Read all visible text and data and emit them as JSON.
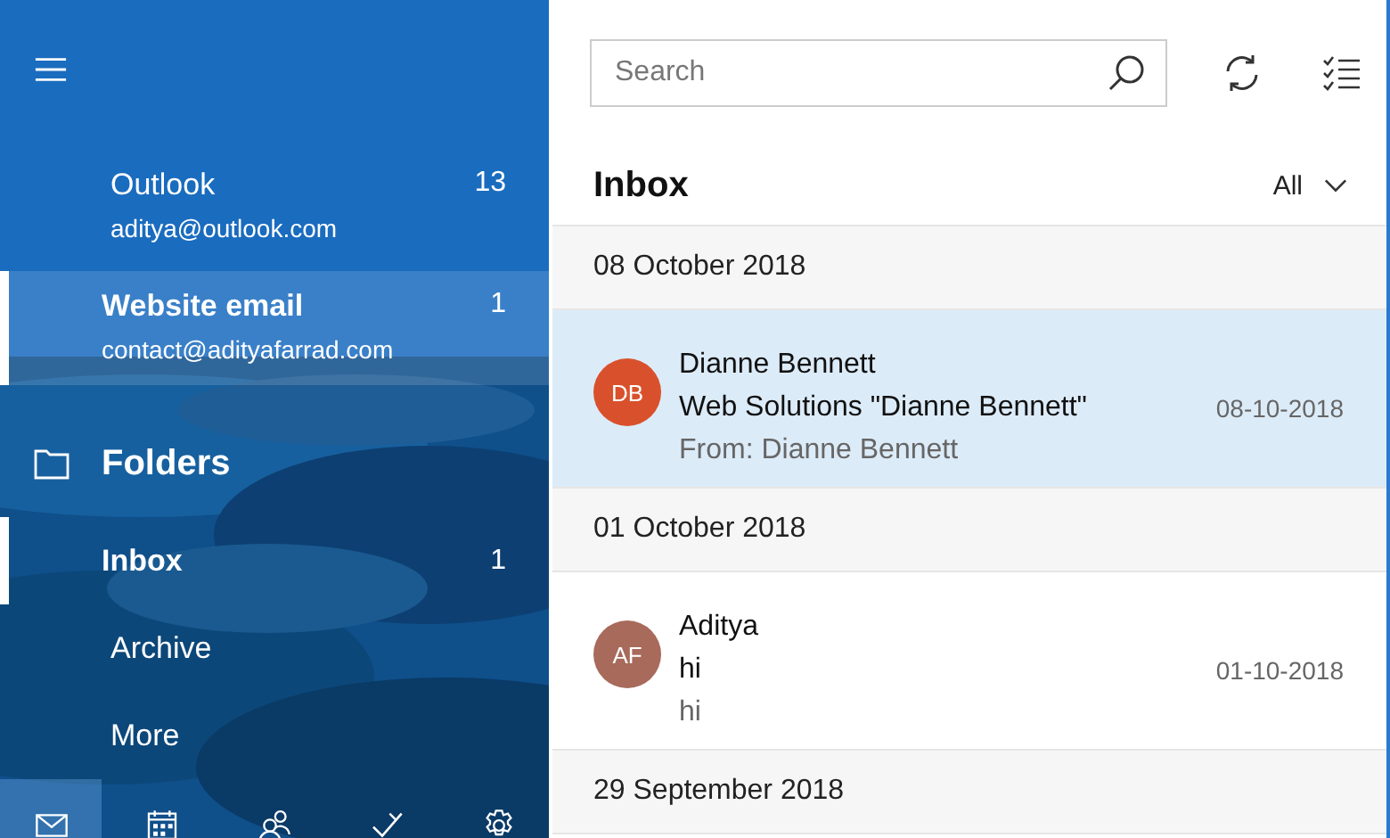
{
  "accounts": [
    {
      "name": "Outlook",
      "count": "13",
      "email": "aditya@outlook.com",
      "selected": false
    },
    {
      "name": "Website email",
      "count": "1",
      "email": "contact@adityafarrad.com",
      "selected": true
    }
  ],
  "folders_title": "Folders",
  "folders": [
    {
      "label": "Inbox",
      "count": "1",
      "selected": true
    },
    {
      "label": "Archive",
      "selected": false
    },
    {
      "label": "More",
      "selected": false
    }
  ],
  "bottom_nav": [
    {
      "kind": "mail",
      "selected": true
    },
    {
      "kind": "calendar",
      "selected": false
    },
    {
      "kind": "people",
      "selected": false
    },
    {
      "kind": "todo",
      "selected": false
    },
    {
      "kind": "settings",
      "selected": false
    }
  ],
  "search": {
    "placeholder": "Search"
  },
  "list_title": "Inbox",
  "filter": "All",
  "groups": [
    {
      "date": "08 October 2018",
      "messages": [
        {
          "initials": "DB",
          "color": "#d9512c",
          "sender": "Dianne Bennett",
          "subject": "Web Solutions \"Dianne Bennett\"",
          "preview": "From: Dianne Bennett",
          "date": "08-10-2018",
          "selected": true
        }
      ]
    },
    {
      "date": "01 October 2018",
      "messages": [
        {
          "initials": "AF",
          "color": "#a86a5b",
          "sender": "Aditya",
          "subject": "hi",
          "preview": "hi",
          "date": "01-10-2018",
          "selected": false
        }
      ]
    },
    {
      "date": "29 September 2018"
    }
  ]
}
